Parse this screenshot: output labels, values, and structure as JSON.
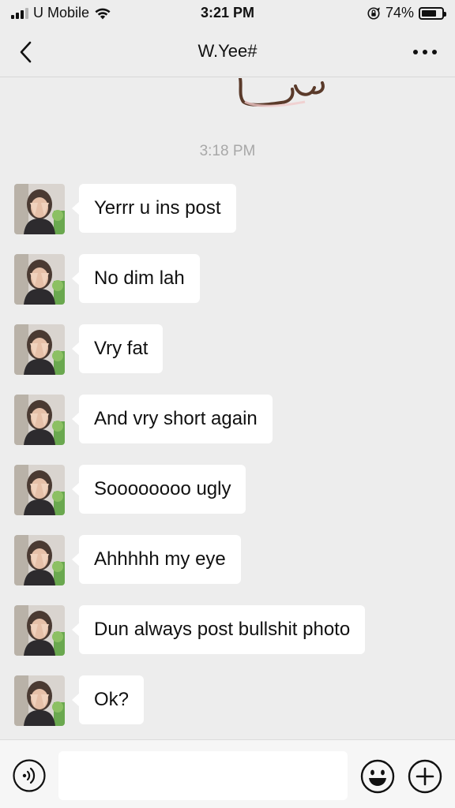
{
  "status_bar": {
    "carrier": "U Mobile",
    "time": "3:21 PM",
    "battery_percent": "74%",
    "battery_level": 0.74,
    "signal_bars": 3
  },
  "nav": {
    "title": "W.Yee#",
    "back_icon": "chevron-left-icon",
    "more_icon": "more-horizontal-icon"
  },
  "chat": {
    "timestamp": "3:18 PM",
    "messages": [
      {
        "text": "Yerrr u ins post"
      },
      {
        "text": "No dim lah"
      },
      {
        "text": "Vry fat"
      },
      {
        "text": "And vry short again"
      },
      {
        "text": "Soooooooo ugly"
      },
      {
        "text": "Ahhhhh my eye"
      },
      {
        "text": "Dun always post bullshit photo"
      },
      {
        "text": "Ok?"
      }
    ]
  },
  "input_bar": {
    "value": "",
    "voice_icon": "voice-icon",
    "emoji_icon": "emoji-icon",
    "plus_icon": "plus-circle-icon"
  },
  "colors": {
    "background": "#ededed",
    "bubble": "#ffffff",
    "timestamp": "#a8a8a8"
  }
}
